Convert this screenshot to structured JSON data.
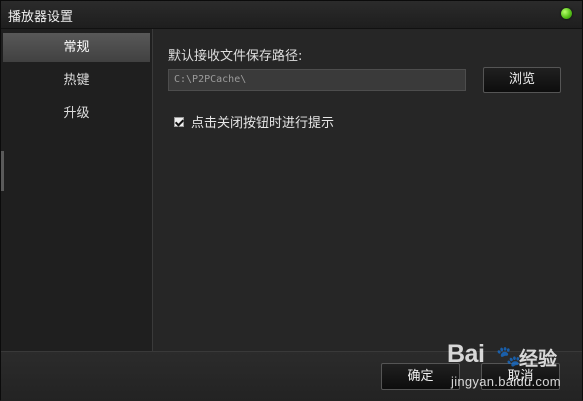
{
  "window": {
    "title": "播放器设置",
    "status_color": "#58c21a"
  },
  "sidebar": {
    "items": [
      {
        "label": "常规",
        "active": true
      },
      {
        "label": "热键",
        "active": false
      },
      {
        "label": "升级",
        "active": false
      }
    ]
  },
  "general": {
    "path_label": "默认接收文件保存路径:",
    "path_value": "C:\\P2PCache\\",
    "browse_label": "浏览",
    "exit_prompt_checked": true,
    "exit_prompt_label": "点击关闭按钮时进行提示"
  },
  "footer": {
    "ok_label": "确定",
    "cancel_label": "取消"
  },
  "watermark": {
    "brand": "Bai",
    "brand_cn": "经验",
    "url": "jingyan.baidu.com"
  }
}
